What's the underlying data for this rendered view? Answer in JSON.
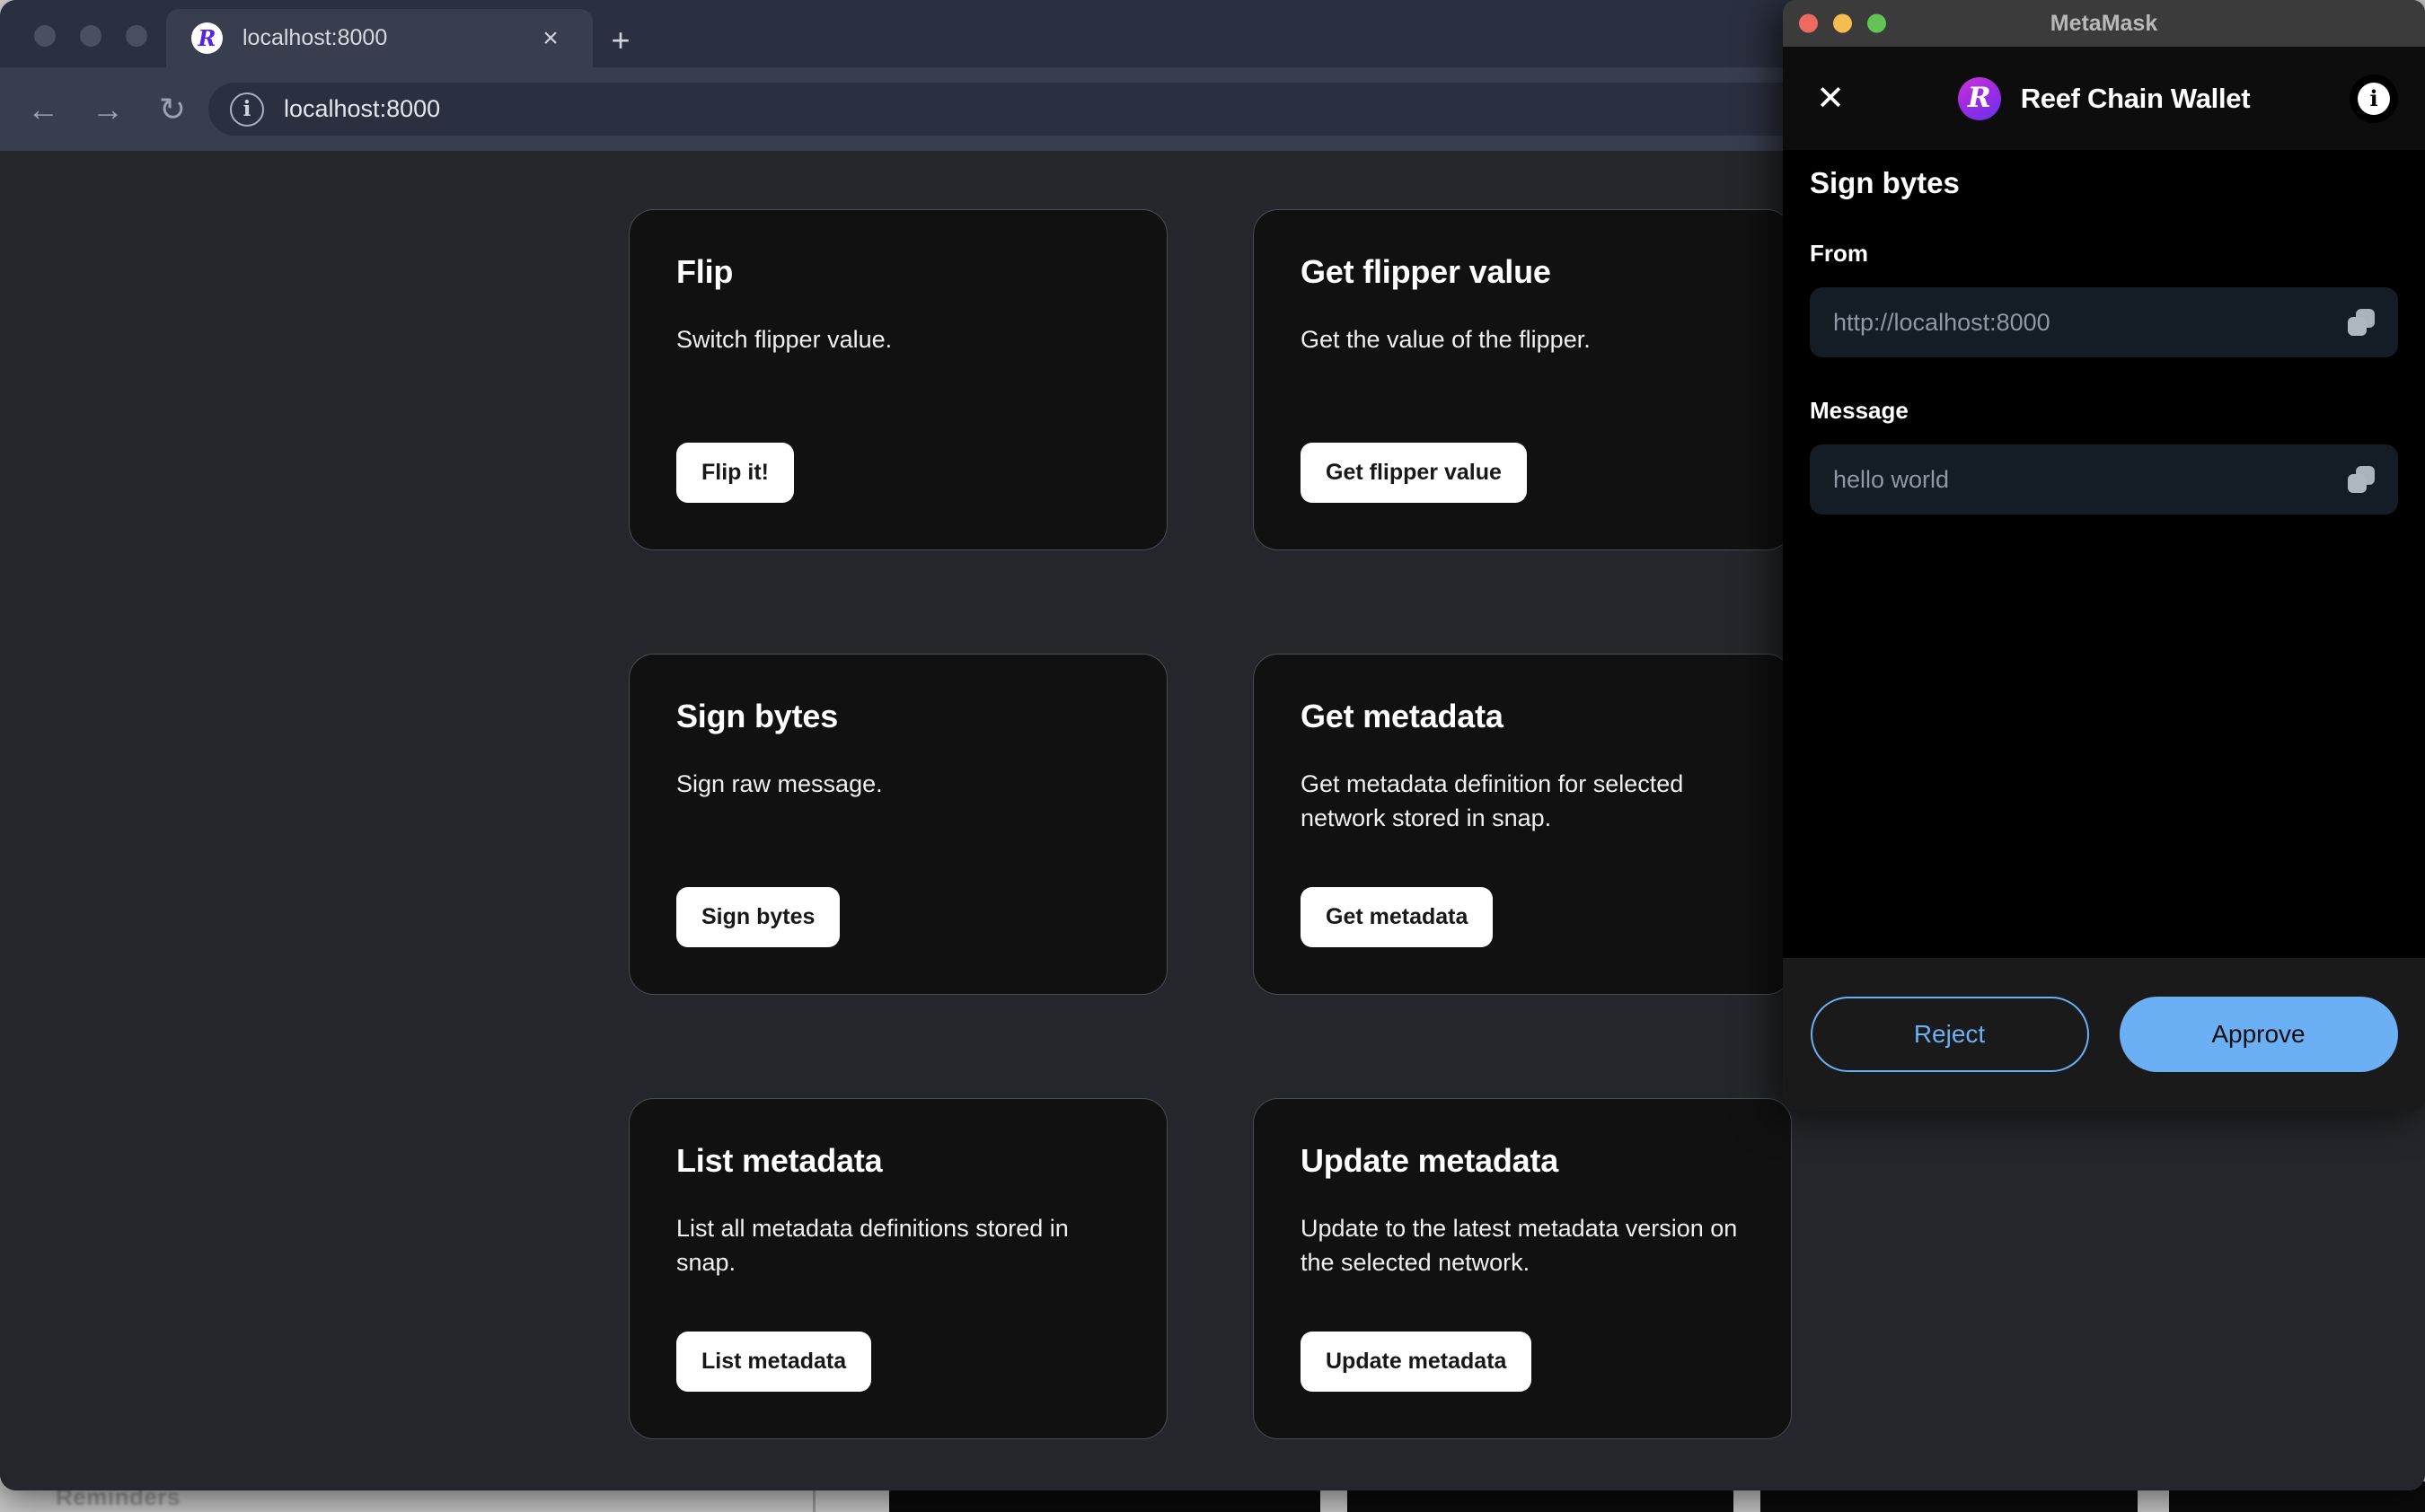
{
  "desktop": {
    "background_app_title": "Reminders"
  },
  "browser": {
    "tab": {
      "title": "localhost:8000",
      "favicon_letter": "R",
      "close_label": "×"
    },
    "new_tab_label": "+",
    "toolbar": {
      "back_label": "←",
      "forward_label": "→",
      "reload_label": "↻",
      "site_info_label": "i",
      "url": "localhost:8000"
    }
  },
  "dapp": {
    "cards": [
      {
        "title": "Flip",
        "description": "Switch flipper value.",
        "button": "Flip it!"
      },
      {
        "title": "Get flipper value",
        "description": "Get the value of the flipper.",
        "button": "Get flipper value"
      },
      {
        "title": "Sign bytes",
        "description": "Sign raw message.",
        "button": "Sign bytes"
      },
      {
        "title": "Get metadata",
        "description": "Get metadata definition for selected network stored in snap.",
        "button": "Get metadata"
      },
      {
        "title": "List metadata",
        "description": "List all metadata definitions stored in snap.",
        "button": "List metadata"
      },
      {
        "title": "Update metadata",
        "description": "Update to the latest metadata version on the selected network.",
        "button": "Update metadata"
      }
    ]
  },
  "metamask": {
    "window_title": "MetaMask",
    "close_label": "✕",
    "brand_logo_letter": "R",
    "brand_name": "Reef Chain Wallet",
    "info_label": "i",
    "section_title": "Sign bytes",
    "fields": [
      {
        "label": "From",
        "value": "http://localhost:8000"
      },
      {
        "label": "Message",
        "value": "hello world"
      }
    ],
    "reject_label": "Reject",
    "approve_label": "Approve",
    "colors": {
      "accent_blue": "#6bb0f5",
      "field_background": "#141c26",
      "panel_background": "#000000"
    }
  }
}
